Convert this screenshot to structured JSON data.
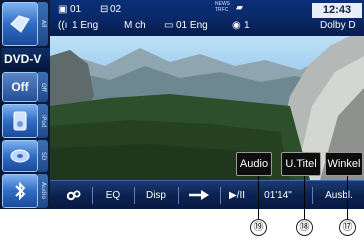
{
  "sources": {
    "items": [
      {
        "label": "All",
        "icon": "av-icon"
      },
      {
        "label": "Off",
        "icon": "off-icon"
      },
      {
        "label": "iPod",
        "icon": "ipod-icon"
      },
      {
        "label": "SD",
        "icon": "sd-card-icon"
      },
      {
        "label": "Audio",
        "icon": "bluetooth-icon"
      }
    ],
    "current": "DVD-V",
    "off_label": "Off"
  },
  "topbar": {
    "title_number": "01",
    "chapter_number": "02",
    "audio_track": "1 Eng",
    "channel": "M ch",
    "subtitle_track": "01 Eng",
    "angle": "1",
    "news_line1": "NEWS",
    "news_line2": "TRFC",
    "clock": "12:43",
    "audio_format": "Dolby D"
  },
  "overlay": {
    "audio_label": "Audio",
    "subtitle_label": "U.Titel",
    "angle_label": "Winkel"
  },
  "controls": {
    "settings_icon": "gear-icon",
    "eq_label": "EQ",
    "disp_label": "Disp",
    "arrow_icon": "right-arrow-icon",
    "play_pause_label": "▶/II",
    "elapsed_time": "01'14\"",
    "off_label": "Ausbl."
  },
  "callouts": {
    "c19": "⑲",
    "c18": "⑱",
    "c17": "⑰"
  },
  "colors": {
    "top_bar": "#0a2a6a",
    "control_bar": "#0c2350",
    "source_button": "#2f6dc4"
  }
}
